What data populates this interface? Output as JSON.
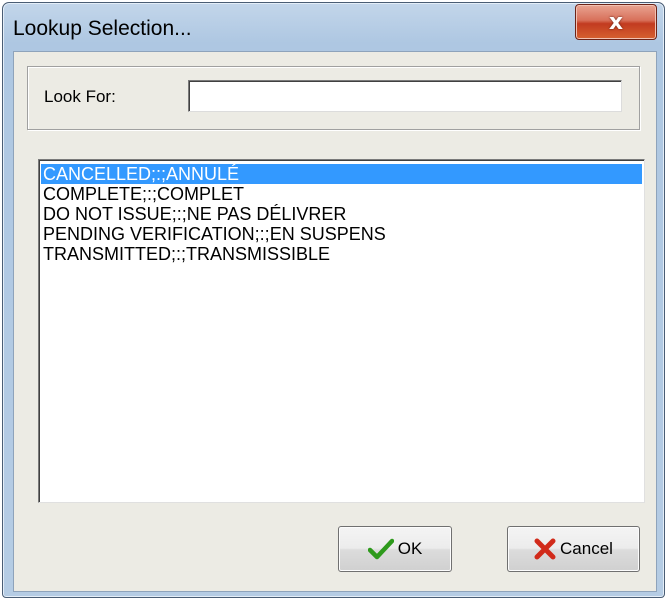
{
  "window": {
    "title": "Lookup Selection...",
    "close_label": "x"
  },
  "search": {
    "label": "Look For:",
    "value": "",
    "placeholder": ""
  },
  "list": {
    "items": [
      {
        "label": "CANCELLED;:;ANNULÉ",
        "selected": true
      },
      {
        "label": "COMPLETE;:;COMPLET",
        "selected": false
      },
      {
        "label": "DO NOT ISSUE;:;NE PAS DÉLIVRER",
        "selected": false
      },
      {
        "label": "PENDING VERIFICATION;:;EN SUSPENS",
        "selected": false
      },
      {
        "label": "TRANSMITTED;:;TRANSMISSIBLE",
        "selected": false
      }
    ]
  },
  "buttons": {
    "ok_label": "OK",
    "ok_icon": "checkmark-icon",
    "cancel_label": "Cancel",
    "cancel_icon": "red-x-icon"
  },
  "colors": {
    "selection": "#3399ff",
    "close_button": "#c23b20",
    "ok_icon": "#2e9a1c",
    "cancel_icon": "#d12a1a"
  }
}
